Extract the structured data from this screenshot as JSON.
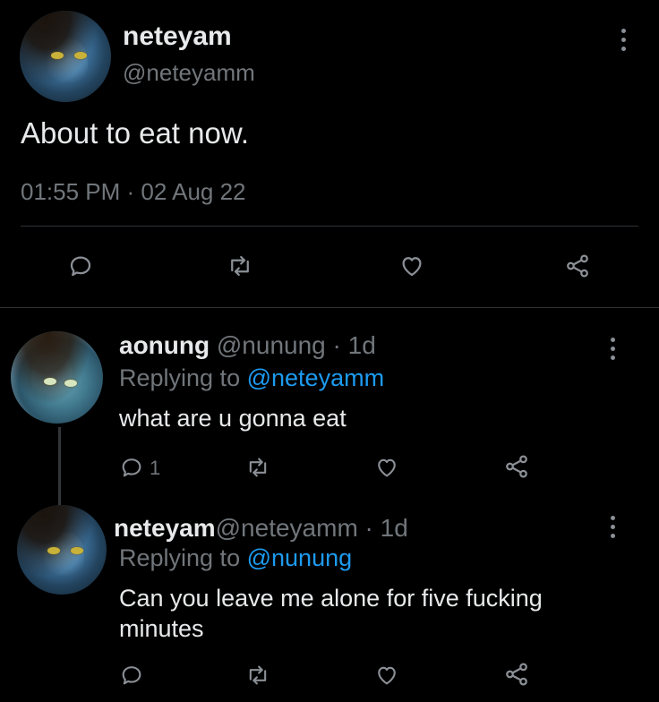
{
  "main_tweet": {
    "display_name": "neteyam",
    "handle": "@neteyamm",
    "text": "About to eat now.",
    "timestamp": "01:55 PM · 02 Aug 22"
  },
  "reply1": {
    "display_name": "aonung",
    "handle": "@nunung",
    "age": "· 1d",
    "replying_prefix": "Replying to",
    "replying_to": "@neteyamm",
    "text": "what are u gonna eat",
    "reply_count": "1"
  },
  "reply2": {
    "display_name": "neteyam",
    "handle": "@neteyamm",
    "age": "· 1d",
    "replying_prefix": "Replying to",
    "replying_to": "@nunung",
    "text": "Can you leave me alone for five fucking minutes"
  },
  "icons": {
    "reply": "reply-icon",
    "retweet": "retweet-icon",
    "like": "like-icon",
    "share": "share-icon",
    "more": "more-icon"
  },
  "colors": {
    "background": "#000000",
    "text": "#e7e9ea",
    "muted": "#71767b",
    "link": "#1d9bf0",
    "divider": "#2f3336"
  }
}
